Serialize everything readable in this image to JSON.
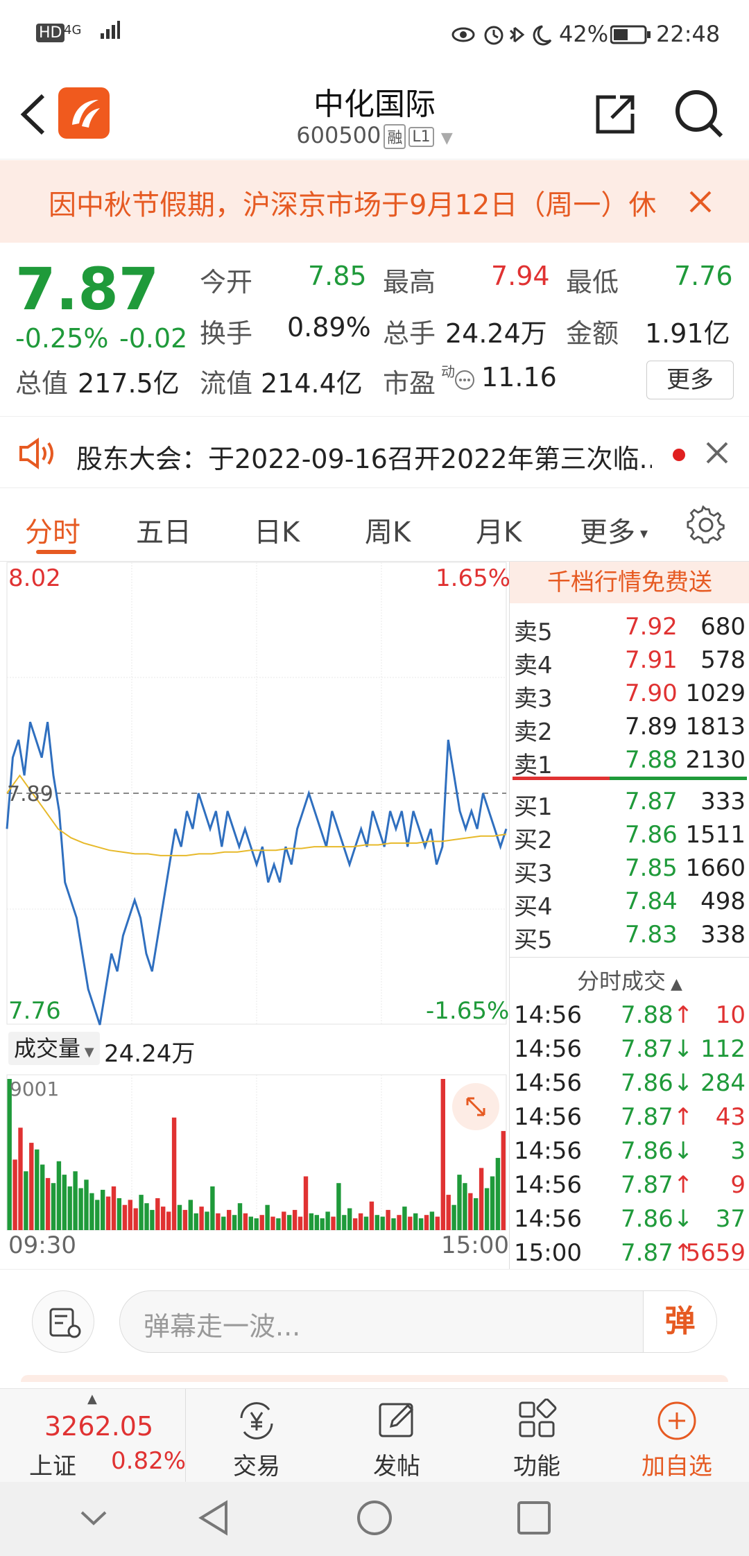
{
  "status_bar": {
    "left_icons": [
      "HD",
      "4G"
    ],
    "battery": "42%",
    "time": "22:48"
  },
  "header": {
    "title": "中化国际",
    "code": "600500",
    "tag_rong": "融",
    "tag_level": "L1"
  },
  "notice": {
    "text": "因中秋节假期，沪深京市场于9月12日（周一）休"
  },
  "quote": {
    "price": "7.87",
    "change_pct": "-0.25%",
    "change_abs": "-0.02",
    "open_label": "今开",
    "open": "7.85",
    "high_label": "最高",
    "high": "7.94",
    "low_label": "最低",
    "low": "7.76",
    "turnover_label": "换手",
    "turnover": "0.89%",
    "volume_label": "总手",
    "volume": "24.24万",
    "amount_label": "金额",
    "amount": "1.91亿",
    "mktcap_label": "总值",
    "mktcap": "217.5亿",
    "float_label": "流值",
    "float": "214.4亿",
    "pe_label": "市盈",
    "pe_sup": "动",
    "pe": "11.16",
    "more_button": "更多"
  },
  "announcement": {
    "text": "股东大会：于2022-09-16召开2022年第三次临..."
  },
  "tabs": [
    {
      "label": "分时"
    },
    {
      "label": "五日"
    },
    {
      "label": "日K"
    },
    {
      "label": "周K"
    },
    {
      "label": "月K"
    },
    {
      "label": "更多"
    }
  ],
  "chart": {
    "top_left": "8.02",
    "top_right": "1.65%",
    "bottom_left": "7.76",
    "bottom_right": "-1.65%",
    "ref_label": "7.89",
    "volume_selector": "成交量",
    "volume_total": "24.24万",
    "volume_max": "9001",
    "time_start": "09:30",
    "time_end": "15:00"
  },
  "chart_data": {
    "type": "line",
    "title": "",
    "xlabel": "",
    "ylabel": "",
    "xlim": [
      "09:30",
      "15:00"
    ],
    "ylim": [
      7.76,
      8.02
    ],
    "reference_price": 7.89,
    "series": [
      {
        "values": [
          7.87,
          7.91,
          7.92,
          7.9,
          7.93,
          7.92,
          7.91,
          7.93,
          7.9,
          7.88,
          7.84,
          7.83,
          7.82,
          7.8,
          7.78,
          7.77,
          7.76,
          7.78,
          7.8,
          7.79,
          7.81,
          7.82,
          7.83,
          7.82,
          7.8,
          7.79,
          7.81,
          7.83,
          7.85,
          7.87,
          7.86,
          7.88,
          7.87,
          7.89,
          7.88,
          7.87,
          7.88,
          7.86,
          7.88,
          7.87,
          7.86,
          7.87,
          7.86,
          7.85,
          7.86,
          7.84,
          7.85,
          7.84,
          7.86,
          7.85,
          7.87,
          7.88,
          7.89,
          7.88,
          7.87,
          7.86,
          7.88,
          7.87,
          7.86,
          7.85,
          7.86,
          7.87,
          7.86,
          7.88,
          7.87,
          7.86,
          7.88,
          7.87,
          7.88,
          7.86,
          7.88,
          7.87,
          7.86,
          7.87,
          7.85,
          7.86,
          7.92,
          7.9,
          7.88,
          7.87,
          7.88,
          7.87,
          7.89,
          7.88,
          7.87,
          7.86,
          7.87
        ]
      },
      {
        "values": [
          7.89,
          7.9,
          7.89,
          7.88,
          7.87,
          7.865,
          7.862,
          7.86,
          7.858,
          7.857,
          7.856,
          7.856,
          7.855,
          7.855,
          7.855,
          7.856,
          7.856,
          7.857,
          7.857,
          7.858,
          7.858,
          7.858,
          7.859,
          7.859,
          7.86,
          7.86,
          7.86,
          7.86,
          7.861,
          7.861,
          7.862,
          7.862,
          7.862,
          7.863,
          7.863,
          7.864,
          7.865,
          7.866,
          7.866,
          7.867
        ]
      }
    ],
    "volume_values": [
      9001,
      4200,
      6100,
      3500,
      5200,
      4800,
      3900,
      3100,
      2800,
      4100,
      3300,
      2600,
      3500,
      2500,
      3000,
      2200,
      1800,
      2400,
      2000,
      2600,
      1900,
      1500,
      1800,
      1300,
      2100,
      1600,
      1200,
      1900,
      1400,
      1100,
      6700,
      1500,
      1200,
      1800,
      1000,
      1400,
      1100,
      2600,
      1000,
      800,
      1200,
      900,
      1600,
      1000,
      800,
      700,
      900,
      1500,
      800,
      700,
      1100,
      900,
      1200,
      800,
      3200,
      1000,
      900,
      700,
      1100,
      800,
      2800,
      900,
      1300,
      700,
      1000,
      800,
      1700,
      900,
      800,
      1200,
      700,
      900,
      1400,
      800,
      1000,
      700,
      900,
      1100,
      800,
      9001,
      2100,
      1500,
      3300,
      2800,
      2200,
      1900,
      3700,
      2500,
      3200,
      4300,
      5900
    ]
  },
  "orderbook": {
    "banner": "千档行情免费送",
    "asks": [
      {
        "label": "卖5",
        "price": "7.92",
        "qty": "680"
      },
      {
        "label": "卖4",
        "price": "7.91",
        "qty": "578"
      },
      {
        "label": "卖3",
        "price": "7.90",
        "qty": "1029"
      },
      {
        "label": "卖2",
        "price": "7.89",
        "qty": "1813"
      },
      {
        "label": "卖1",
        "price": "7.88",
        "qty": "2130"
      }
    ],
    "bids": [
      {
        "label": "买1",
        "price": "7.87",
        "qty": "333"
      },
      {
        "label": "买2",
        "price": "7.86",
        "qty": "1511"
      },
      {
        "label": "买3",
        "price": "7.85",
        "qty": "1660"
      },
      {
        "label": "买4",
        "price": "7.84",
        "qty": "498"
      },
      {
        "label": "买5",
        "price": "7.83",
        "qty": "338"
      }
    ],
    "trades_title": "分时成交",
    "trades": [
      {
        "time": "14:56",
        "price": "7.88",
        "dir": "↑",
        "qty": "10"
      },
      {
        "time": "14:56",
        "price": "7.87",
        "dir": "↓",
        "qty": "112"
      },
      {
        "time": "14:56",
        "price": "7.86",
        "dir": "↓",
        "qty": "284"
      },
      {
        "time": "14:56",
        "price": "7.87",
        "dir": "↑",
        "qty": "43"
      },
      {
        "time": "14:56",
        "price": "7.86",
        "dir": "↓",
        "qty": "3"
      },
      {
        "time": "14:56",
        "price": "7.87",
        "dir": "↑",
        "qty": "9"
      },
      {
        "time": "14:56",
        "price": "7.86",
        "dir": "↓",
        "qty": "37"
      },
      {
        "time": "15:00",
        "price": "7.87",
        "dir": "↑",
        "qty": "5659"
      }
    ]
  },
  "comment": {
    "placeholder": "弹幕走一波...",
    "danmu_button": "弹"
  },
  "bottom_nav": {
    "index_value": "3262.05",
    "index_name": "上证",
    "index_change": "0.82%",
    "items": [
      {
        "label": "交易"
      },
      {
        "label": "发帖"
      },
      {
        "label": "功能"
      },
      {
        "label": "加自选"
      }
    ]
  },
  "colors": {
    "up": "#e03232",
    "down": "#1f9a3a",
    "accent": "#e65a22",
    "line_price": "#2f6fbf",
    "line_avg": "#e7b92a"
  }
}
